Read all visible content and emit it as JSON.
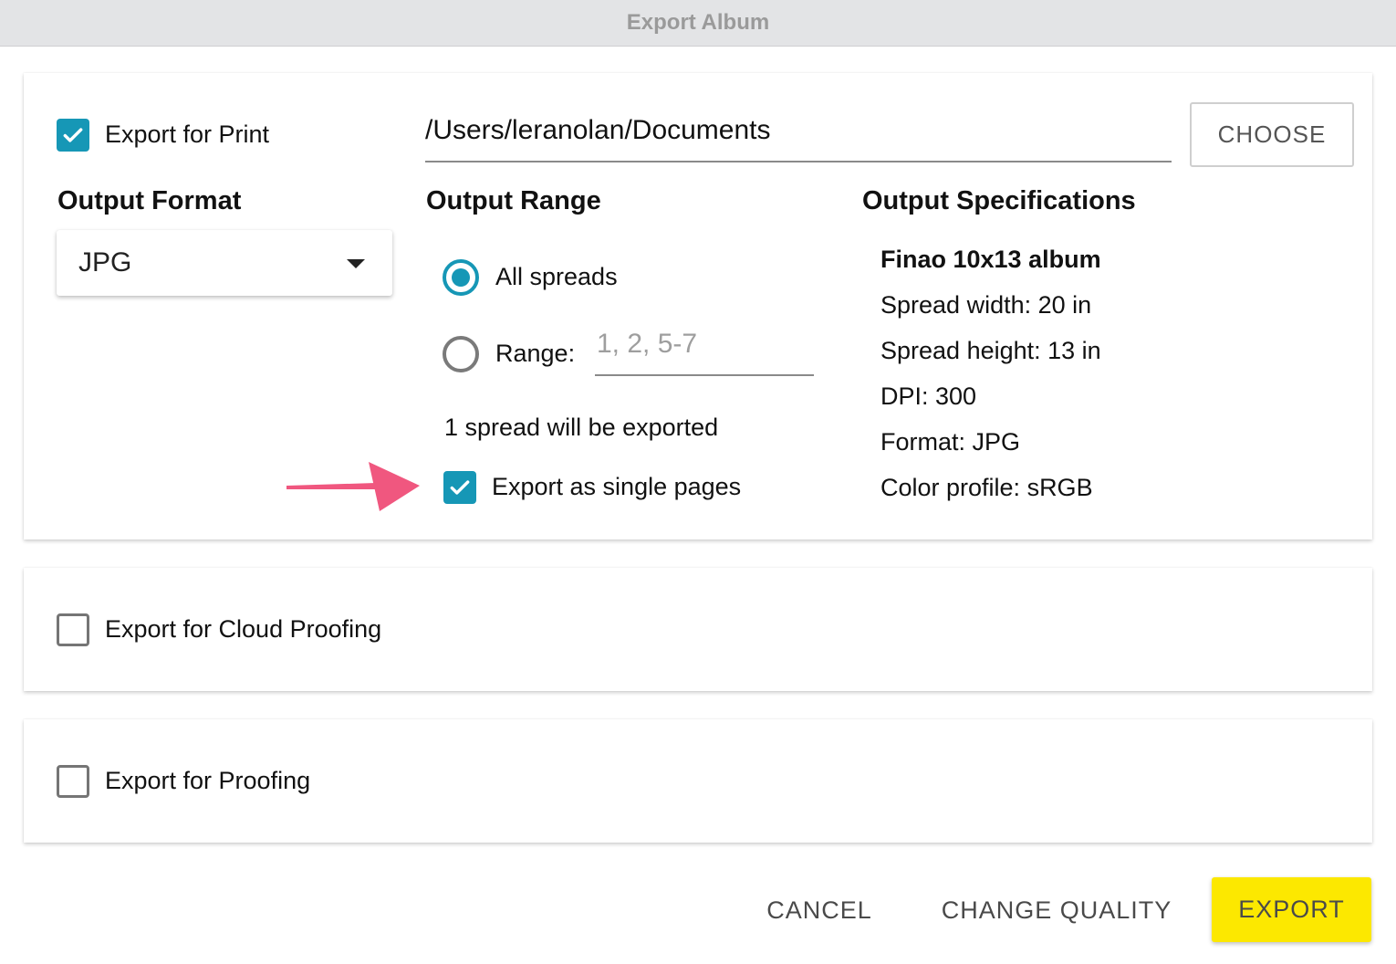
{
  "window": {
    "title": "Export Album"
  },
  "print_section": {
    "checkbox_label": "Export for Print",
    "checked": true,
    "folder_path": "/Users/leranolan/Documents",
    "choose_label": "CHOOSE",
    "output_format": {
      "heading": "Output Format",
      "selected": "JPG"
    },
    "output_range": {
      "heading": "Output Range",
      "options": [
        {
          "label": "All spreads",
          "selected": true
        },
        {
          "label": "Range:",
          "selected": false
        }
      ],
      "range_placeholder": "1, 2, 5-7",
      "range_value": "",
      "summary": "1 spread will be exported",
      "single_pages_label": "Export as single pages",
      "single_pages_checked": true
    },
    "output_specifications": {
      "heading": "Output Specifications",
      "product": "Finao 10x13 album",
      "lines": [
        "Spread width: 20 in",
        "Spread height: 13 in",
        "DPI: 300",
        "Format: JPG",
        "Color profile: sRGB"
      ]
    }
  },
  "cloud_section": {
    "checkbox_label": "Export for Cloud Proofing",
    "checked": false
  },
  "proof_section": {
    "checkbox_label": "Export for Proofing",
    "checked": false
  },
  "footer": {
    "cancel_label": "CANCEL",
    "change_quality_label": "CHANGE QUALITY",
    "export_label": "EXPORT"
  },
  "colors": {
    "accent": "#1697b6",
    "export_button": "#fce800",
    "annotation_arrow": "#f0577f"
  },
  "annotation": {
    "icon": "arrow-right-icon",
    "points_to": "single_pages_checkbox"
  }
}
